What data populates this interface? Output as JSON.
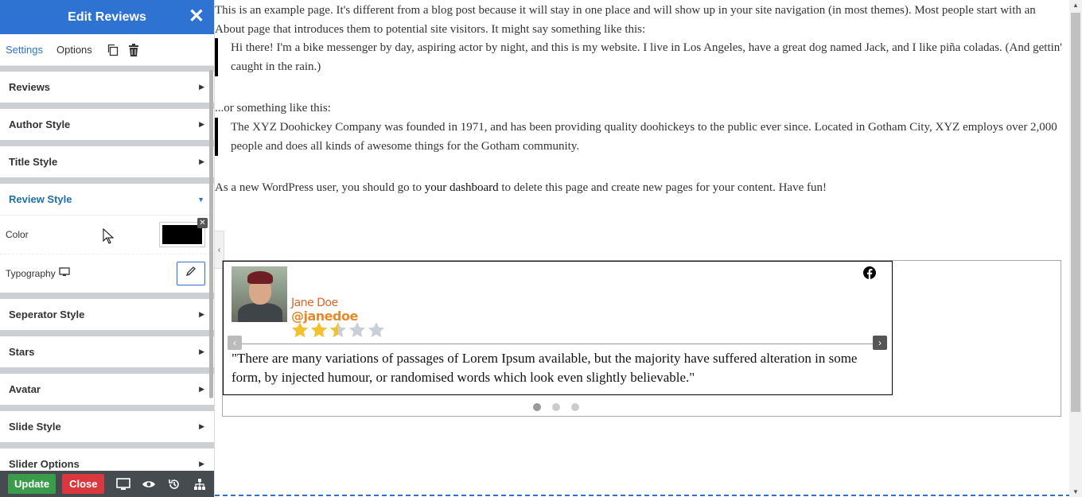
{
  "panel": {
    "title": "Edit Reviews",
    "close_glyph": "✕",
    "tabs": [
      {
        "label": "Settings",
        "active": true
      },
      {
        "label": "Options",
        "active": false
      }
    ],
    "tab_icons": [
      "copy-icon",
      "trash-icon"
    ],
    "sections": [
      {
        "label": "Reviews",
        "open": false
      },
      {
        "label": "Author Style",
        "open": false
      },
      {
        "label": "Title Style",
        "open": false
      },
      {
        "label": "Review Style",
        "open": true
      },
      {
        "label": "Seperator Style",
        "open": false
      },
      {
        "label": "Stars",
        "open": false
      },
      {
        "label": "Avatar",
        "open": false
      },
      {
        "label": "Slide Style",
        "open": false
      },
      {
        "label": "Slider Options",
        "open": false
      }
    ],
    "review_style": {
      "color_label": "Color",
      "color_value": "#000000",
      "typography_label": "Typography"
    },
    "footer": {
      "update_label": "Update",
      "close_label": "Close",
      "icons": [
        "desktop-icon",
        "preview-eye-icon",
        "history-icon",
        "sitemap-icon"
      ]
    }
  },
  "content": {
    "p1": "This is an example page. It's different from a blog post because it will stay in one place and will show up in your site navigation (in most themes). Most people start with an About page that introduces them to potential site visitors. It might say something like this:",
    "quote1": "Hi there! I'm a bike messenger by day, aspiring actor by night, and this is my website. I live in Los Angeles, have a great dog named Jack, and I like piña coladas. (And gettin' caught in the rain.)",
    "p2": "...or something like this:",
    "quote2": "The XYZ Doohickey Company was founded in 1971, and has been providing quality doohickeys to the public ever since. Located in Gotham City, XYZ employs over 2,000 people and does all kinds of awesome things for the Gotham community.",
    "p3_before": "As a new WordPress user, you should go to ",
    "p3_link": "your dashboard",
    "p3_after": " to delete this page and create new pages for your content. Have fun!"
  },
  "review": {
    "author_name": "Jane Doe",
    "author_handle": "@janedoe",
    "rating": 2.5,
    "max_rating": 5,
    "source_icon": "facebook-icon",
    "text": "\"There are many variations of passages of Lorem Ipsum available, but the majority have suffered alteration in some form, by injected humour, or randomised words which look even slightly believable.\"",
    "slides": 3,
    "active_slide": 0
  },
  "colors": {
    "panel_header": "#2e72d2",
    "star_filled": "#f2c12e",
    "star_empty": "#c8cfd6",
    "author_name": "#e0622b",
    "author_handle": "#e38a2c",
    "update_button": "#3a9b4a",
    "close_button": "#d9383e"
  }
}
